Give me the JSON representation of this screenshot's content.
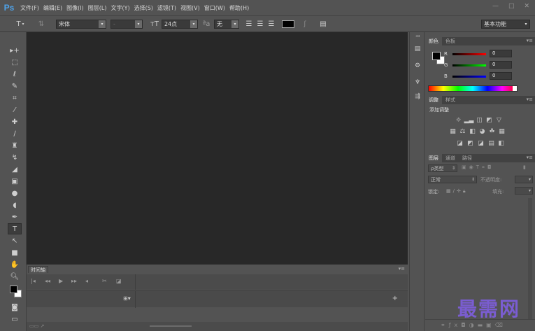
{
  "app": {
    "logo": "Ps"
  },
  "menu": [
    "文件(F)",
    "编辑(E)",
    "图像(I)",
    "图层(L)",
    "文字(Y)",
    "选择(S)",
    "滤镜(T)",
    "视图(V)",
    "窗口(W)",
    "帮助(H)"
  ],
  "window_controls": {
    "minimize": "—",
    "restore": "□",
    "close": "✕"
  },
  "options": {
    "tool_glyph": "T",
    "font_family": "宋体",
    "font_size": "24点",
    "antialias": "无",
    "workspace": "基本功能",
    "color_swatch": "#000000"
  },
  "color_panel": {
    "tabs": [
      "颜色",
      "色板"
    ],
    "r_label": "R",
    "g_label": "G",
    "b_label": "B",
    "r": "0",
    "g": "0",
    "b": "0"
  },
  "adjust_panel": {
    "tabs": [
      "调整",
      "样式"
    ],
    "heading": "添加调整"
  },
  "layers_panel": {
    "tabs": [
      "图层",
      "通道",
      "路径"
    ],
    "filter_kind": "ρ类型",
    "blend_mode": "正常",
    "opacity_label": "不透明度:",
    "lock_label": "锁定:",
    "fill_label": "填充:"
  },
  "timeline": {
    "tab": "时间轴",
    "add_label": "+",
    "track_icon": "⊞▾"
  },
  "watermark": "最需网",
  "colors": {
    "accent": "#4fa3ea",
    "canvas": "#282828",
    "panel": "#535353"
  }
}
